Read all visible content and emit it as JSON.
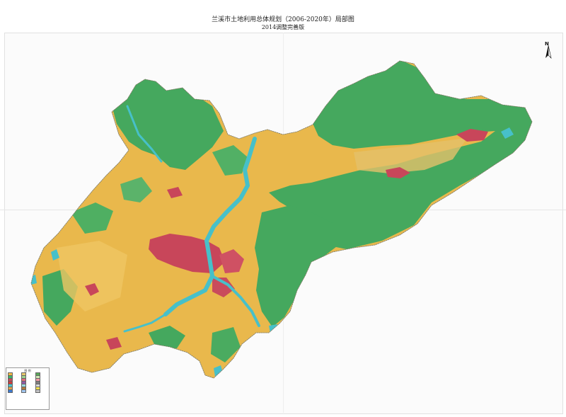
{
  "title": {
    "line1": "兰溪市土地利用总体规划（2006-2020年）局部图",
    "line2": "2014调整完善版"
  },
  "north_label": "N",
  "legend": {
    "title": "图 例",
    "items": [
      {
        "color": "#f2b843"
      },
      {
        "color": "#e8c86a"
      },
      {
        "color": "#5aa85a"
      },
      {
        "color": "#3fb56b"
      },
      {
        "color": "#9fd38a"
      },
      {
        "color": "#cfe8b5"
      },
      {
        "color": "#c84a5a"
      },
      {
        "color": "#e06b7a"
      },
      {
        "color": "#f29aa5"
      },
      {
        "color": "#d03c3c"
      },
      {
        "color": "#8e5aa8"
      },
      {
        "color": "#7f7f7f"
      },
      {
        "color": "#4fc4cc"
      },
      {
        "color": "#9bd9e0"
      },
      {
        "color": "#d8d8d8"
      },
      {
        "color": "#e3a24a"
      },
      {
        "color": "#b07b3e"
      },
      {
        "color": "#f4e04d"
      },
      {
        "color": "#3e7bd1"
      },
      {
        "color": "#a2c6ef"
      },
      {
        "color": "#c2c2c2"
      }
    ]
  },
  "colors": {
    "forest": "#45a85e",
    "farmland": "#e9b84c",
    "urban": "#c8465a",
    "water": "#47c0c9",
    "background": "#ffffff"
  }
}
